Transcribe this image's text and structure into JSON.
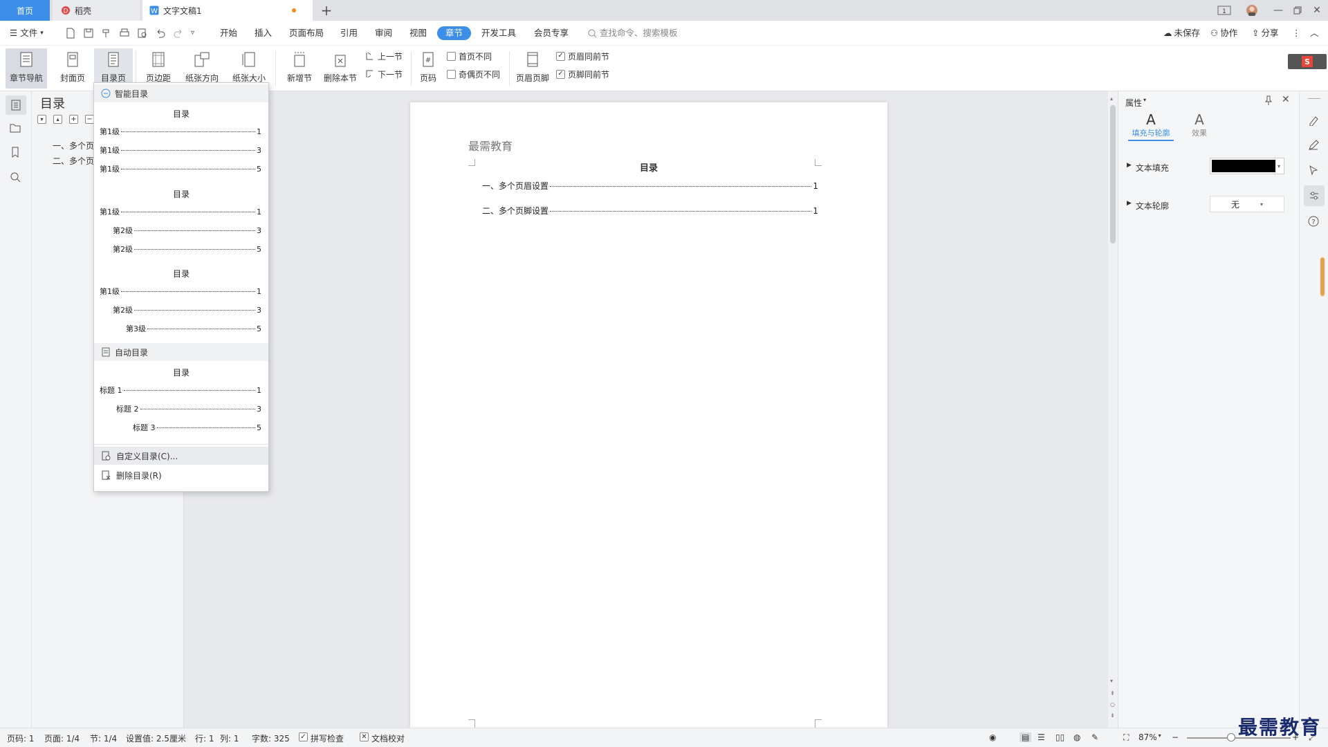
{
  "titlebar": {
    "tabs": [
      {
        "label": "首页"
      },
      {
        "label": "稻壳"
      },
      {
        "label": "文字文稿1"
      }
    ],
    "add_tab": "+",
    "page_indicator": "1"
  },
  "menubar": {
    "file_label": "文件",
    "items": [
      "开始",
      "插入",
      "页面布局",
      "引用",
      "审阅",
      "视图",
      "章节",
      "开发工具",
      "会员专享"
    ],
    "search_placeholder": "查找命令、搜索模板",
    "unsaved": "未保存",
    "collab": "协作",
    "share": "分享"
  },
  "ribbon": {
    "chapter_nav": "章节导航",
    "cover": "封面页",
    "toc_page": "目录页",
    "margins": "页边距",
    "orientation": "纸张方向",
    "paper_size": "纸张大小",
    "new_section": "新增节",
    "delete_section": "删除本节",
    "prev_section": "上一节",
    "next_section": "下一节",
    "page_number": "页码",
    "first_page_diff": "首页不同",
    "odd_even_diff": "奇偶页不同",
    "header_footer": "页眉页脚",
    "header_same": "页眉同前节",
    "footer_same": "页脚同前节"
  },
  "navpane": {
    "title": "目录",
    "items": [
      "一、多个页",
      "二、多个页"
    ]
  },
  "dropdown": {
    "smart_toc": "智能目录",
    "auto_toc": "自动目录",
    "custom_toc": "自定义目录(C)...",
    "delete_toc": "删除目录(R)",
    "block1": {
      "title": "目录",
      "lines": [
        {
          "t": "第1级",
          "p": "1"
        },
        {
          "t": "第1级",
          "p": "3"
        },
        {
          "t": "第1级",
          "p": "5"
        }
      ]
    },
    "block2": {
      "title": "目录",
      "lines": [
        {
          "t": "第1级",
          "p": "1"
        },
        {
          "t": "第2级",
          "p": "3"
        },
        {
          "t": "第2级",
          "p": "5"
        }
      ]
    },
    "block3": {
      "title": "目录",
      "lines": [
        {
          "t": "第1级",
          "p": "1"
        },
        {
          "t": "第2级",
          "p": "3"
        },
        {
          "t": "第3级",
          "p": "5"
        }
      ]
    },
    "block4": {
      "title": "目录",
      "lines": [
        {
          "t": "标题 1",
          "p": "1"
        },
        {
          "t": "标题 2",
          "p": "3"
        },
        {
          "t": "标题 3",
          "p": "5"
        }
      ]
    }
  },
  "document": {
    "header_text": "最需教育",
    "toc_title": "目录",
    "toc_lines": [
      {
        "t": "一、多个页眉设置",
        "p": "1"
      },
      {
        "t": "二、多个页脚设置",
        "p": "1"
      }
    ]
  },
  "rpanel": {
    "title": "属性",
    "tab_fill": "填充与轮廓",
    "tab_effect": "效果",
    "text_fill": "文本填充",
    "text_outline": "文本轮廓",
    "outline_value": "无",
    "fill_color": "#000000",
    "accent": "#3c8ee8"
  },
  "statusbar": {
    "page_num": "页码: 1",
    "pages": "页面: 1/4",
    "section": "节: 1/4",
    "setting": "设置值: 2.5厘米",
    "row": "行: 1",
    "col": "列: 1",
    "words": "字数: 325",
    "spell": "拼写检查",
    "proof": "文档校对",
    "zoom": "87%"
  },
  "watermark": "最需教育"
}
